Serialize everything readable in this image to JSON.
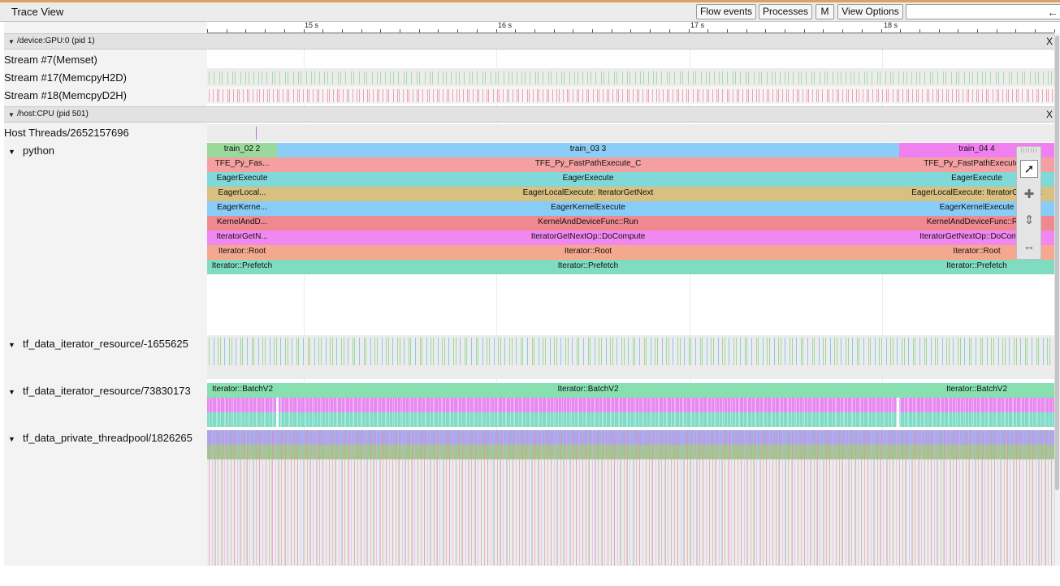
{
  "app": {
    "title": "Trace View"
  },
  "toolbar": {
    "flow_events": "Flow events",
    "processes": "Processes",
    "m": "M",
    "view_options": "View Options",
    "search_placeholder": "",
    "back_icon": "back-arrow-icon"
  },
  "ruler": {
    "labels": [
      "15 s",
      "16 s",
      "17 s",
      "18 s"
    ]
  },
  "groups": [
    {
      "title": "/device:GPU:0 (pid 1)",
      "close": "X"
    },
    {
      "title": "/host:CPU (pid 501)",
      "close": "X"
    }
  ],
  "gpu_rows": [
    "Stream #7(Memset)",
    "Stream #17(MemcpyH2D)",
    "Stream #18(MemcpyD2H)"
  ],
  "cpu_rows": {
    "host_threads": "Host Threads/2652157696",
    "python": "python",
    "iter_res_1": "tf_data_iterator_resource/-1655625",
    "iter_res_2": "tf_data_iterator_resource/73830173",
    "threadpool": "tf_data_private_threadpool/1826265"
  },
  "python_stack": {
    "segments": [
      {
        "name": "train_02",
        "label": "train_02 2"
      },
      {
        "name": "train_03",
        "label": "train_03 3"
      },
      {
        "name": "train_04",
        "label": "train_04 4"
      }
    ],
    "rows": [
      [
        "TFE_Py_Fas...",
        "TFE_Py_FastPathExecute_C",
        "TFE_Py_FastPathExecute_C"
      ],
      [
        "EagerExecute",
        "EagerExecute",
        "EagerExecute"
      ],
      [
        "EagerLocal...",
        "EagerLocalExecute: IteratorGetNext",
        "EagerLocalExecute: IteratorGetNext"
      ],
      [
        "EagerKerne...",
        "EagerKernelExecute",
        "EagerKernelExecute"
      ],
      [
        "KernelAndD...",
        "KernelAndDeviceFunc::Run",
        "KernelAndDeviceFunc::Run"
      ],
      [
        "IteratorGetN...",
        "IteratorGetNextOp::DoCompute",
        "IteratorGetNextOp::DoCompute"
      ],
      [
        "Iterator::Root",
        "Iterator::Root",
        "Iterator::Root"
      ],
      [
        "Iterator::Prefetch",
        "Iterator::Prefetch",
        "Iterator::Prefetch"
      ]
    ]
  },
  "batch_row": {
    "labels": [
      "Iterator::BatchV2",
      "Iterator::BatchV2",
      "Iterator::BatchV2"
    ]
  },
  "colors": {
    "train_02": "#9bd89b",
    "train_03": "#8ccdf5",
    "train_04": "#f080f0",
    "row_colors": [
      "#f5a0a0",
      "#80d8d8",
      "#d8c080",
      "#88ccf8",
      "#f08890",
      "#f088f0",
      "#f5a890",
      "#80dcc0"
    ],
    "batch": "#88e0b0",
    "stream_h2d": "#a8dca8",
    "stream_d2h": "#f0a0b8"
  },
  "tools": [
    "select-pointer-icon",
    "pan-icon",
    "zoom-icon",
    "timing-icon"
  ]
}
